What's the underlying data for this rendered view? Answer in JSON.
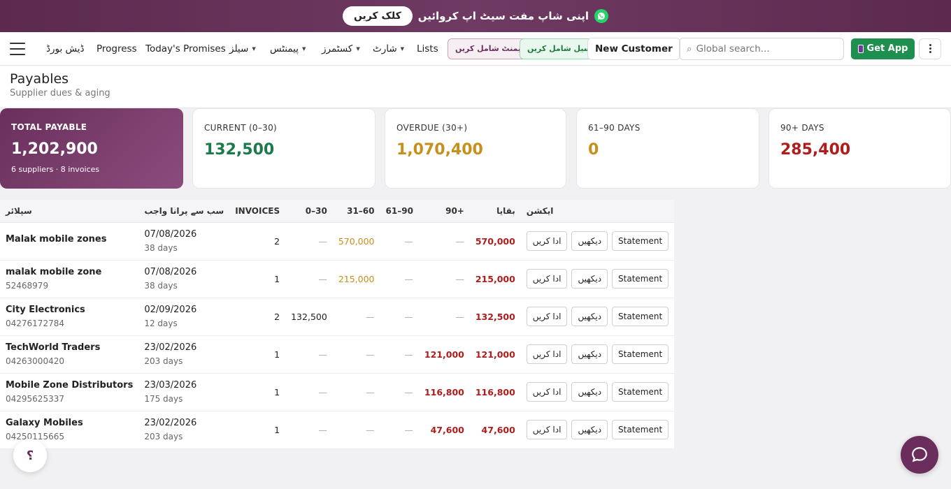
{
  "promo": {
    "cta": "کلک کریں",
    "message": "اپنی شاپ مفت سیٹ اپ کروائیں",
    "icon": "whatsapp-icon"
  },
  "nav": {
    "dashboard": "ڈیش بورڈ",
    "progress": "Progress",
    "promises": "Today's Promises",
    "sales": "سیلز",
    "payments": "پیمنٹس",
    "customers": "کسٹمرز",
    "chart": "شارٹ",
    "lists": "Lists",
    "add_payment": "پیمنٹ شامل کریں",
    "add_sale": "سیل شامل کریں",
    "new_customer": "New Customer",
    "search_placeholder": "Global search...",
    "get_app": "Get App"
  },
  "page": {
    "title": "Payables",
    "subtitle": "Supplier dues & aging"
  },
  "cards": [
    {
      "label": "TOTAL PAYABLE",
      "value": "1,202,900",
      "sub": "6 suppliers · 8 invoices",
      "color": "#ffffff"
    },
    {
      "label": "CURRENT (0–30)",
      "value": "132,500",
      "color": "#1a7a4a"
    },
    {
      "label": "OVERDUE (30+)",
      "value": "1,070,400",
      "color": "#c7901c"
    },
    {
      "label": "61–90 DAYS",
      "value": "0",
      "color": "#c7901c"
    },
    {
      "label": "90+ DAYS",
      "value": "285,400",
      "color": "#b01c1c"
    }
  ],
  "table": {
    "headers": {
      "supplier": "سپلائر",
      "oldest": "سب سے پرانا واجب",
      "invoices": "INVOICES",
      "b0_30": "0–30",
      "b31_60": "31–60",
      "b61_90": "61–90",
      "b90": "90+",
      "balance": "بقایا",
      "actions": "ایکشن"
    },
    "buttons": {
      "pay": "ادا کریں",
      "view": "دیکھیں",
      "statement": "Statement"
    },
    "rows": [
      {
        "name": "Malak mobile zones",
        "phone": "",
        "date": "07/08/2026",
        "days": "38 days",
        "invoices": "2",
        "b0_30": "—",
        "b31_60": "570,000",
        "b61_90": "—",
        "b90": "—",
        "balance": "570,000"
      },
      {
        "name": "malak mobile zone",
        "phone": "52468979",
        "date": "07/08/2026",
        "days": "38 days",
        "invoices": "1",
        "b0_30": "—",
        "b31_60": "215,000",
        "b61_90": "—",
        "b90": "—",
        "balance": "215,000"
      },
      {
        "name": "City Electronics",
        "phone": "04276172784",
        "date": "02/09/2026",
        "days": "12 days",
        "invoices": "2",
        "b0_30": "132,500",
        "b31_60": "—",
        "b61_90": "—",
        "b90": "—",
        "balance": "132,500"
      },
      {
        "name": "TechWorld Traders",
        "phone": "04263000420",
        "date": "23/02/2026",
        "days": "203 days",
        "invoices": "1",
        "b0_30": "—",
        "b31_60": "—",
        "b61_90": "—",
        "b90": "121,000",
        "balance": "121,000"
      },
      {
        "name": "Mobile Zone Distributors",
        "phone": "04295625337",
        "date": "23/03/2026",
        "days": "175 days",
        "invoices": "1",
        "b0_30": "—",
        "b31_60": "—",
        "b61_90": "—",
        "b90": "116,800",
        "balance": "116,800"
      },
      {
        "name": "Galaxy Mobiles",
        "phone": "04250115665",
        "date": "23/02/2026",
        "days": "203 days",
        "invoices": "1",
        "b0_30": "—",
        "b31_60": "—",
        "b61_90": "—",
        "b90": "47,600",
        "balance": "47,600"
      }
    ]
  },
  "help_label": "؟"
}
